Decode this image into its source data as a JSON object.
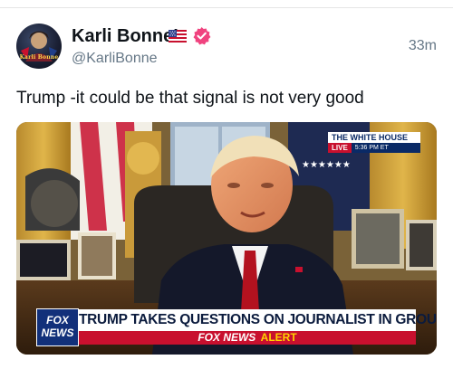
{
  "tweet": {
    "display_name": "Karli Bonne’",
    "flag_icon": "us-flag-icon",
    "verified_icon": "verified-badge-icon",
    "verified_color": "#f0437f",
    "handle": "@KarliBonne",
    "timestamp": "33m",
    "text": "Trump -it could be that signal is not very good"
  },
  "avatar": {
    "caption": "Karli Bonne"
  },
  "media": {
    "live_bug": {
      "title": "THE WHITE HOUSE",
      "live": "LIVE",
      "time": "5:36 PM ET"
    },
    "network_logo_line1": "FOX",
    "network_logo_line2": "NEWS",
    "headline": "TRUMP TAKES QUESTIONS ON JOURNALIST IN GROUP CHAT",
    "subheadline": "FOX NEWS",
    "alert": "ALERT"
  }
}
